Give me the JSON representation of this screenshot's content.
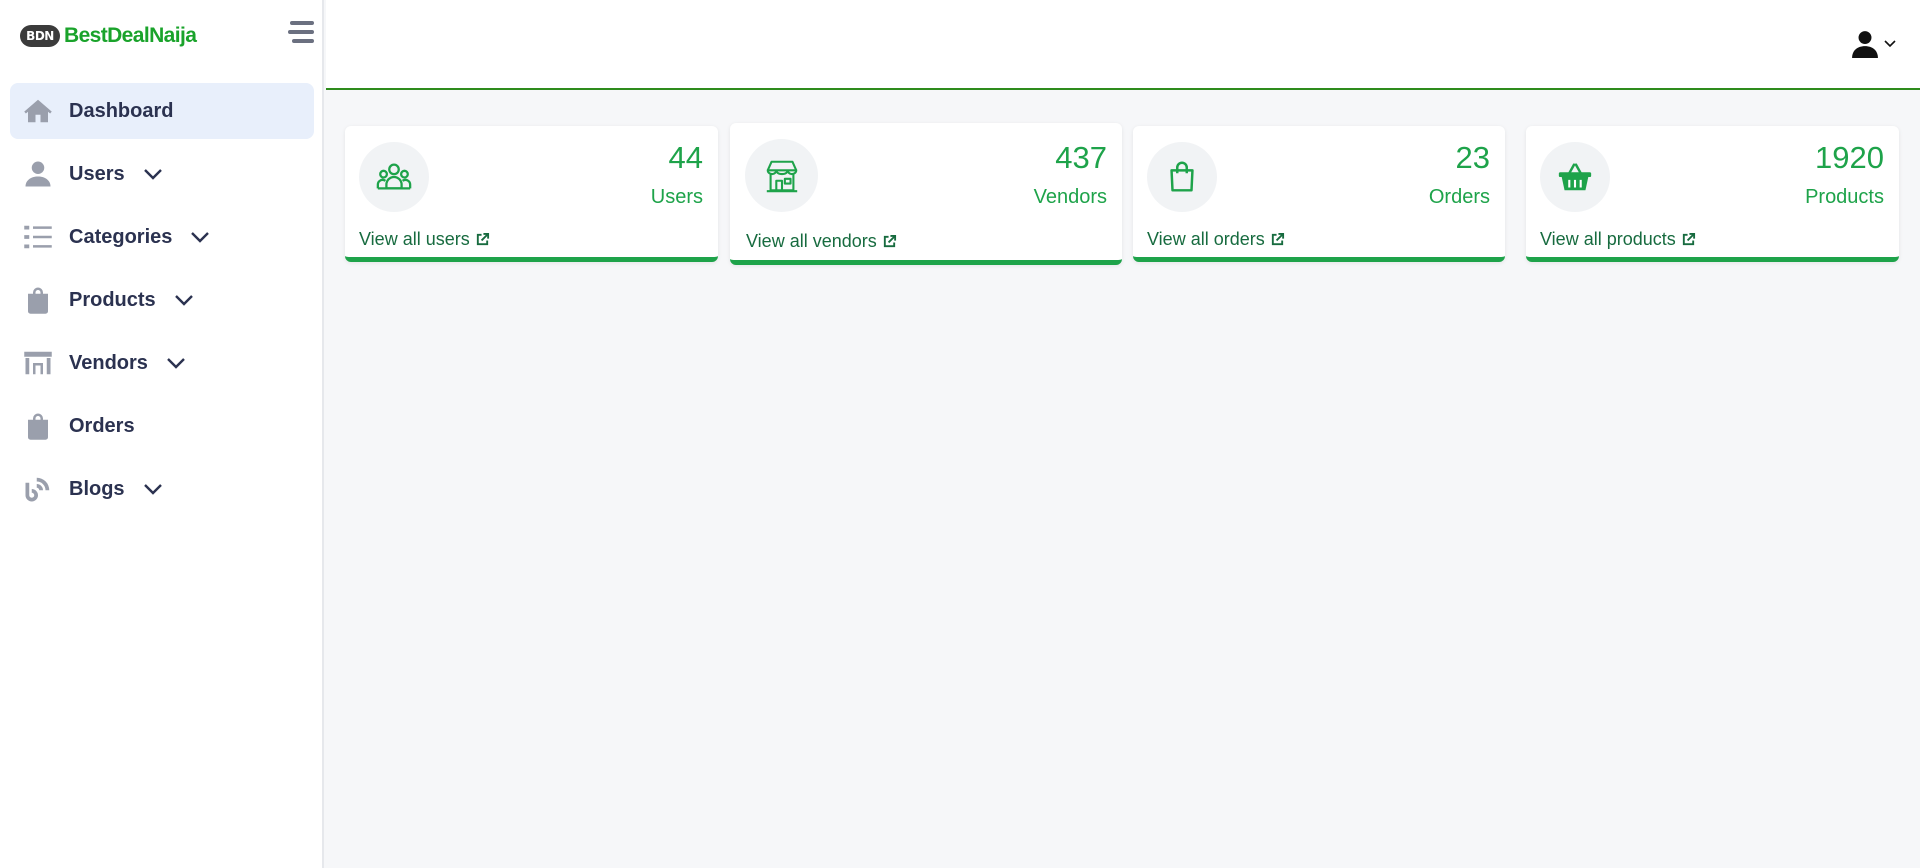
{
  "brand": {
    "badge": "BDN",
    "name": "BestDealNaija"
  },
  "sidebar": {
    "items": [
      {
        "label": "Dashboard",
        "icon": "home-icon",
        "has_submenu": false,
        "active": true
      },
      {
        "label": "Users",
        "icon": "user-icon",
        "has_submenu": true,
        "active": false
      },
      {
        "label": "Categories",
        "icon": "list-icon",
        "has_submenu": true,
        "active": false
      },
      {
        "label": "Products",
        "icon": "shopping-bag-icon",
        "has_submenu": true,
        "active": false
      },
      {
        "label": "Vendors",
        "icon": "store-icon",
        "has_submenu": true,
        "active": false
      },
      {
        "label": "Orders",
        "icon": "shopping-bag-icon",
        "has_submenu": false,
        "active": false
      },
      {
        "label": "Blogs",
        "icon": "blog-icon",
        "has_submenu": true,
        "active": false
      }
    ]
  },
  "topbar": {
    "user_icon": "user-icon",
    "dropdown_icon": "chevron-down-icon"
  },
  "cards": [
    {
      "count": "44",
      "label": "Users",
      "link": "View all users",
      "icon": "users-group-icon"
    },
    {
      "count": "437",
      "label": "Vendors",
      "link": "View all vendors",
      "icon": "store-icon"
    },
    {
      "count": "23",
      "label": "Orders",
      "link": "View all orders",
      "icon": "shopping-bag-icon"
    },
    {
      "count": "1920",
      "label": "Products",
      "link": "View all products",
      "icon": "basket-icon"
    }
  ],
  "colors": {
    "brand_green": "#1aa32b",
    "accent_green": "#1ea34a",
    "link_green": "#176b3f",
    "topbar_border": "#2e8b1c",
    "nav_active_bg": "#e8effb",
    "nav_text": "#2b3250",
    "page_bg": "#f6f7f9"
  }
}
